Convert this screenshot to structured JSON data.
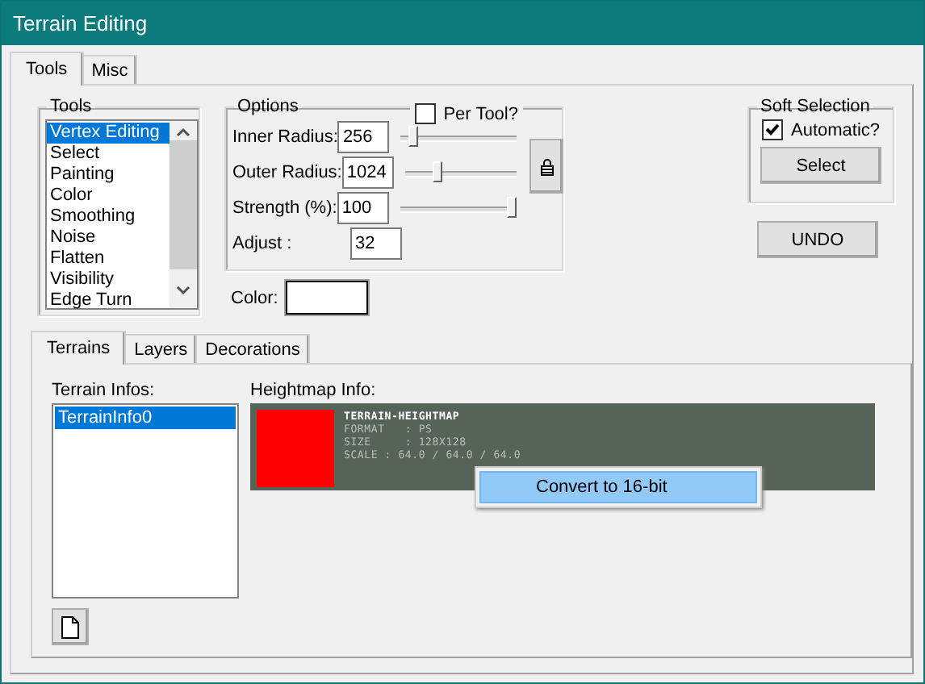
{
  "window": {
    "title": "Terrain Editing"
  },
  "tabs": [
    {
      "label": "Tools",
      "selected": true
    },
    {
      "label": "Misc",
      "selected": false
    }
  ],
  "tools": {
    "title": "Tools",
    "items": [
      {
        "label": "Vertex Editing",
        "selected": true
      },
      {
        "label": "Select",
        "selected": false
      },
      {
        "label": "Painting",
        "selected": false
      },
      {
        "label": "Color",
        "selected": false
      },
      {
        "label": "Smoothing",
        "selected": false
      },
      {
        "label": "Noise",
        "selected": false
      },
      {
        "label": "Flatten",
        "selected": false
      },
      {
        "label": "Visibility",
        "selected": false
      },
      {
        "label": "Edge Turn",
        "selected": false
      }
    ]
  },
  "options": {
    "title": "Options",
    "per_tool": {
      "label": "Per Tool?",
      "checked": false
    },
    "fields": [
      {
        "label": "Inner Radius:",
        "value": "256",
        "level": 0.07
      },
      {
        "label": "Outer Radius:",
        "value": "1024",
        "level": 0.27
      },
      {
        "label": "Strength (%):",
        "value": "100",
        "level": 1
      },
      {
        "label": "Adjust :",
        "value": "32"
      }
    ]
  },
  "soft_selection": {
    "title": "Soft Selection",
    "automatic": {
      "label": "Automatic?",
      "checked": true
    },
    "button": "Select"
  },
  "undo_button": "UNDO",
  "color": {
    "label": "Color:"
  },
  "inner_tabs": [
    {
      "label": "Terrains",
      "selected": true
    },
    {
      "label": "Layers",
      "selected": false
    },
    {
      "label": "Decorations",
      "selected": false
    }
  ],
  "terrain_infos": {
    "label": "Terrain Infos:",
    "items": [
      {
        "label": "TerrainInfo0",
        "selected": true
      }
    ]
  },
  "heightmap": {
    "label": "Heightmap Info:",
    "lines": [
      "TERRAIN-HEIGHTMAP",
      "FORMAT   : PS",
      "SIZE     : 128X128",
      "SCALE : 64.0 / 64.0 / 64.0"
    ]
  },
  "context_menu": {
    "items": [
      {
        "label": "Convert to 16-bit",
        "selected": true
      }
    ]
  }
}
